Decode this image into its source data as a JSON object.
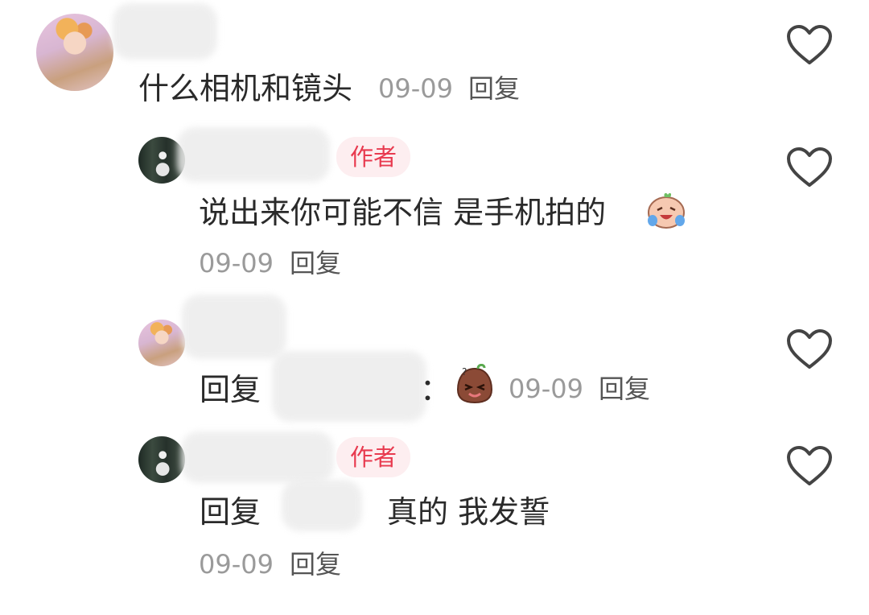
{
  "comments": [
    {
      "text": "什么相机和镜头",
      "time": "09-09",
      "reply": "回复"
    },
    {
      "badge": "作者",
      "text": "说出来你可能不信 是手机拍的",
      "emoji": "crying-laughing-emoji",
      "time": "09-09",
      "reply": "回复"
    },
    {
      "prefix": "回复",
      "colon": "：",
      "emoji": "shy-bean-emoji",
      "time": "09-09",
      "reply": "回复"
    },
    {
      "badge": "作者",
      "prefix": "回复",
      "text": "真的  我发誓",
      "time": "09-09",
      "reply": "回复"
    }
  ],
  "colors": {
    "badge_text": "#e83a4f",
    "badge_bg": "#fdeef0",
    "meta": "#9a9a9a"
  }
}
